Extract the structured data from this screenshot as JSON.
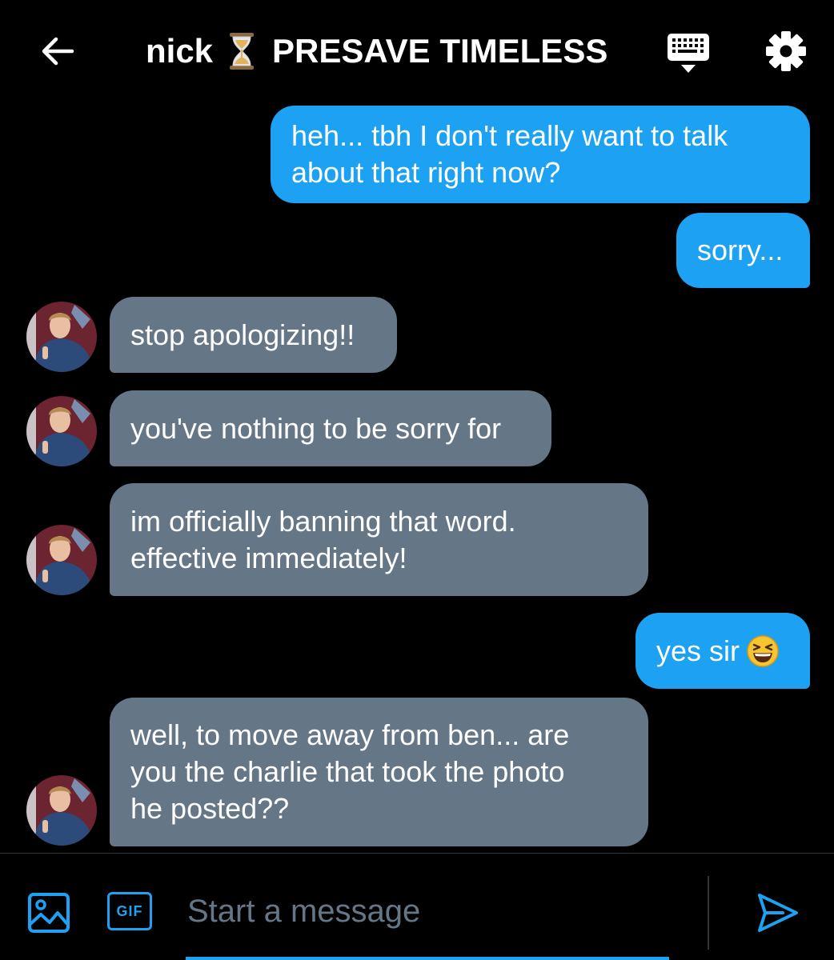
{
  "header": {
    "title_name": "nick",
    "title_tag": "PRESAVE TIMELESS",
    "icons": {
      "back": "arrow-left-icon",
      "hourglass": "hourglass-icon",
      "keyboard": "keyboard-icon",
      "settings": "gear-icon"
    }
  },
  "messages": [
    {
      "direction": "sent",
      "text": "heh... tbh I don't really want to talk\nabout that right now?"
    },
    {
      "direction": "sent",
      "text": "sorry..."
    },
    {
      "direction": "received",
      "text": "stop apologizing!!"
    },
    {
      "direction": "received",
      "text": "you've nothing to be sorry for"
    },
    {
      "direction": "received",
      "text": "im officially banning that word.\neffective immediately!"
    },
    {
      "direction": "sent",
      "text": "yes sir",
      "emoji": "grinning-squinting-face-emoji"
    },
    {
      "direction": "received",
      "text": "well, to move away from ben... are\nyou the charlie that took the photo\nhe posted??"
    }
  ],
  "composer": {
    "placeholder": "Start a message",
    "value": "",
    "gif_label": "GIF",
    "icons": {
      "media": "image-icon",
      "send": "send-icon"
    }
  },
  "colors": {
    "background": "#000000",
    "sent_bubble": "#1da1f2",
    "received_bubble": "#657786",
    "accent": "#1da1f2",
    "placeholder": "#657786"
  }
}
